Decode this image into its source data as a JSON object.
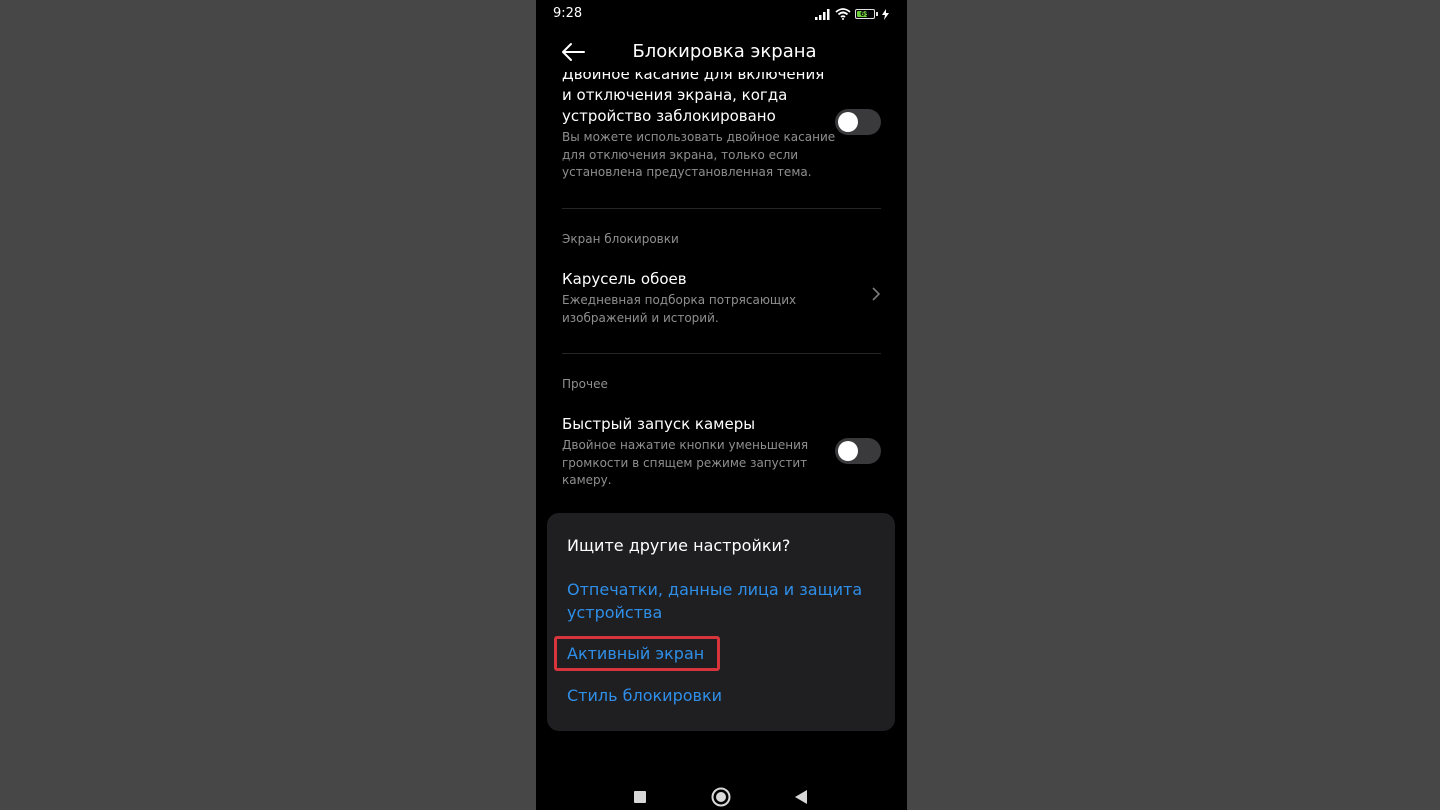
{
  "status_bar": {
    "time": "9:28",
    "icons": [
      "signal-icon",
      "wifi-icon",
      "battery-icon",
      "charging-icon"
    ],
    "battery_level": "69",
    "battery_fraction": 0.69
  },
  "header": {
    "title": "Блокировка экрана",
    "back_icon": "arrow-left-icon"
  },
  "settings": {
    "double_tap": {
      "title": "Двойное касание для включения и отключения экрана, когда устройство заблокировано",
      "subtitle": "Вы можете использовать двойное касание для отключения экрана, только если установлена предустановленная тема.",
      "enabled": false
    },
    "lock_screen_section": "Экран блокировки",
    "wallpaper_carousel": {
      "title": "Карусель обоев",
      "subtitle": "Ежедневная подборка потрясающих изображений и историй."
    },
    "other_section": "Прочее",
    "quick_camera": {
      "title": "Быстрый запуск камеры",
      "subtitle": "Двойное нажатие кнопки уменьшения громкости в спящем режиме запустит камеру.",
      "enabled": false
    }
  },
  "suggestions": {
    "title": "Ищите другие настройки?",
    "links": [
      "Отпечатки, данные лица и защита устройства",
      "Активный экран",
      "Стиль блокировки"
    ],
    "highlighted_index": 1
  },
  "colors": {
    "accent_link": "#2f8fe8",
    "highlight_border": "#d6363b",
    "background": "#000000"
  },
  "nav_bar": {
    "icons": [
      "recents-square-icon",
      "home-circle-icon",
      "back-triangle-icon"
    ]
  }
}
